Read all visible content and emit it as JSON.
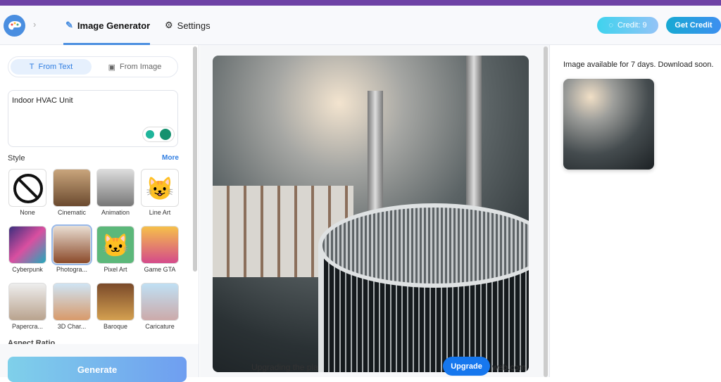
{
  "header": {
    "tabs": [
      {
        "label": "Image Generator",
        "icon": "magic-wand-icon",
        "active": true
      },
      {
        "label": "Settings",
        "icon": "gear-icon",
        "active": false
      }
    ],
    "credit": "Credit: 9",
    "get_credit": "Get Credit"
  },
  "left": {
    "mode_tabs": [
      {
        "label": "From Text",
        "icon": "text-icon",
        "active": true
      },
      {
        "label": "From Image",
        "icon": "image-icon",
        "active": false
      }
    ],
    "prompt": "Indoor HVAC Unit",
    "style_label": "Style",
    "more": "More",
    "styles": [
      {
        "name": "None"
      },
      {
        "name": "Cinematic"
      },
      {
        "name": "Animation"
      },
      {
        "name": "Line Art"
      },
      {
        "name": "Cyberpunk"
      },
      {
        "name": "Photogra...",
        "selected": true
      },
      {
        "name": "Pixel Art"
      },
      {
        "name": "Game GTA"
      },
      {
        "name": "Papercra..."
      },
      {
        "name": "3D Char..."
      },
      {
        "name": "Baroque"
      },
      {
        "name": "Caricature"
      }
    ],
    "aspect_label": "Aspect Ratio",
    "generate": "Generate"
  },
  "main": {
    "watermark_left": "Upgrading the pla",
    "watermark_right": "sta        web.com",
    "upgrade": "Upgrade"
  },
  "right": {
    "notice": "Image available for 7 days. Download soon."
  },
  "colors": {
    "accent": "#2f7de1",
    "topbar": "#6e42a6",
    "upgrade": "#1677ee"
  }
}
